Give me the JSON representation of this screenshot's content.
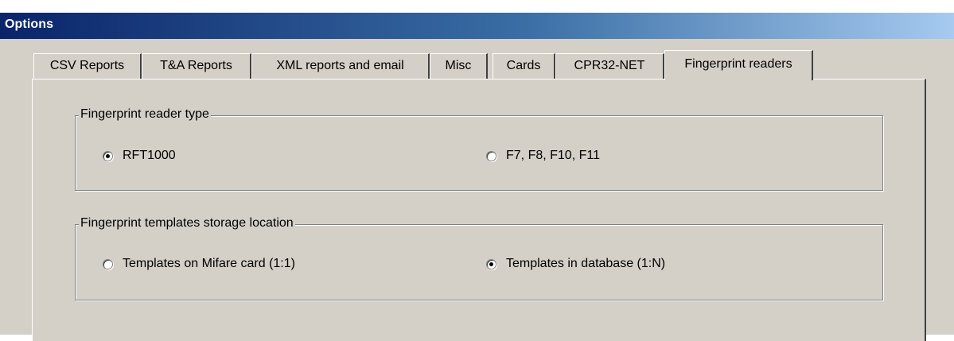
{
  "window": {
    "title": "Options"
  },
  "tabs": [
    {
      "label": "CSV Reports",
      "active": false
    },
    {
      "label": "T&A Reports",
      "active": false
    },
    {
      "label": "XML reports and email",
      "active": false
    },
    {
      "label": "Misc",
      "active": false
    },
    {
      "label": "Cards",
      "active": false
    },
    {
      "label": "CPR32-NET",
      "active": false
    },
    {
      "label": "Fingerprint readers",
      "active": true
    }
  ],
  "reader_type_group": {
    "label": "Fingerprint reader type",
    "options": [
      {
        "label": "RFT1000",
        "checked": true
      },
      {
        "label": "F7, F8, F10, F11",
        "checked": false
      }
    ]
  },
  "storage_group": {
    "label": "Fingerprint templates storage location",
    "options": [
      {
        "label": "Templates on Mifare card (1:1)",
        "checked": false
      },
      {
        "label": "Templates in database (1:N)",
        "checked": true
      }
    ]
  }
}
